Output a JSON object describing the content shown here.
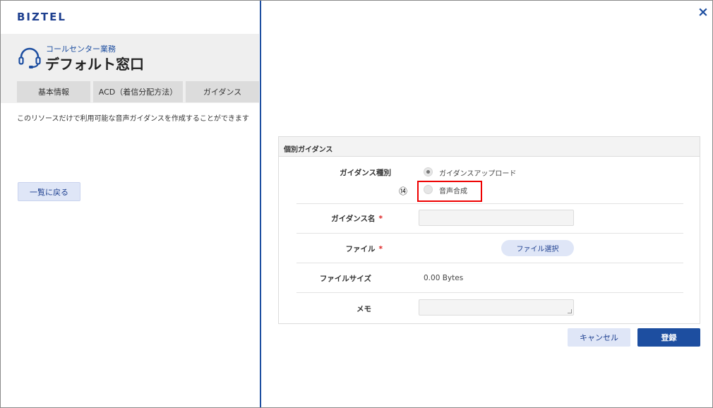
{
  "app": {
    "logo": "BIZTEL"
  },
  "header": {
    "department": "コールセンター業務",
    "title": "デフォルト窓口",
    "icon": "headset-icon"
  },
  "tabs": [
    {
      "label": "基本情報"
    },
    {
      "label": "ACD（着信分配方法）"
    },
    {
      "label": "ガイダンス"
    }
  ],
  "description": "このリソースだけで利用可能な音声ガイダンスを作成することができます",
  "back_button": "一覧に戻る",
  "close_icon": "×",
  "form": {
    "section_title": "個別ガイダンス",
    "guidance_type": {
      "label": "ガイダンス種別",
      "options": [
        {
          "label": "ガイダンスアップロード",
          "checked": true
        },
        {
          "label": "音声合成",
          "checked": false
        }
      ],
      "annotation": "⑭"
    },
    "guidance_name": {
      "label": "ガイダンス名",
      "required_mark": "*",
      "value": ""
    },
    "file": {
      "label": "ファイル",
      "required_mark": "*",
      "button": "ファイル選択"
    },
    "file_size": {
      "label": "ファイルサイズ",
      "value": "0.00 Bytes"
    },
    "memo": {
      "label": "メモ",
      "value": ""
    }
  },
  "actions": {
    "cancel": "キャンセル",
    "submit": "登録"
  },
  "colors": {
    "brand": "#1d4ea0",
    "highlight": "#e00000",
    "required": "#dd2222"
  }
}
